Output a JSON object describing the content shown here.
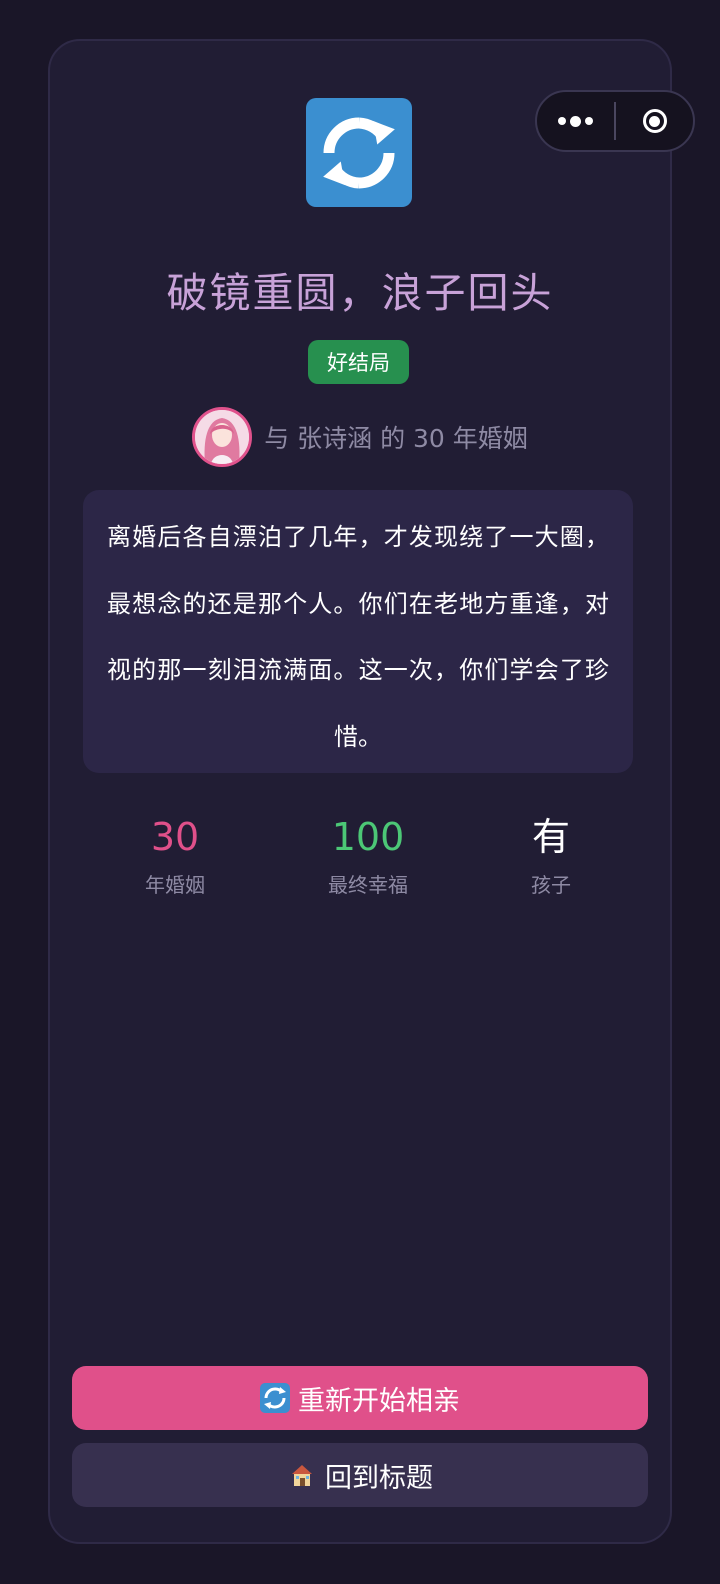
{
  "result": {
    "title": "破镜重圆，浪子回头",
    "badge": "好结局",
    "partner_line": "与 张诗涵 的 30 年婚姻",
    "story": "离婚后各自漂泊了几年，才发现绕了一大圈，最想念的还是那个人。你们在老地方重逢，对视的那一刻泪流满面。这一次，你们学会了珍惜。",
    "logo_icon": "refresh-icon",
    "colors": {
      "title": "#c8a2d8",
      "badge": "#27904f",
      "accent_pink": "#e0508a",
      "accent_green": "#4cc776"
    }
  },
  "stats": [
    {
      "value": "30",
      "label": "年婚姻",
      "color": "#e0508a"
    },
    {
      "value": "100",
      "label": "最终幸福",
      "color": "#4cc776"
    },
    {
      "value": "有",
      "label": "孩子",
      "color": "#ffffff"
    }
  ],
  "actions": {
    "restart_label": "重新开始相亲",
    "restart_icon": "refresh-icon",
    "home_label": "回到标题",
    "home_icon": "house-icon"
  },
  "capsule": {
    "more_icon": "more-dots-icon",
    "close_icon": "target-icon"
  }
}
